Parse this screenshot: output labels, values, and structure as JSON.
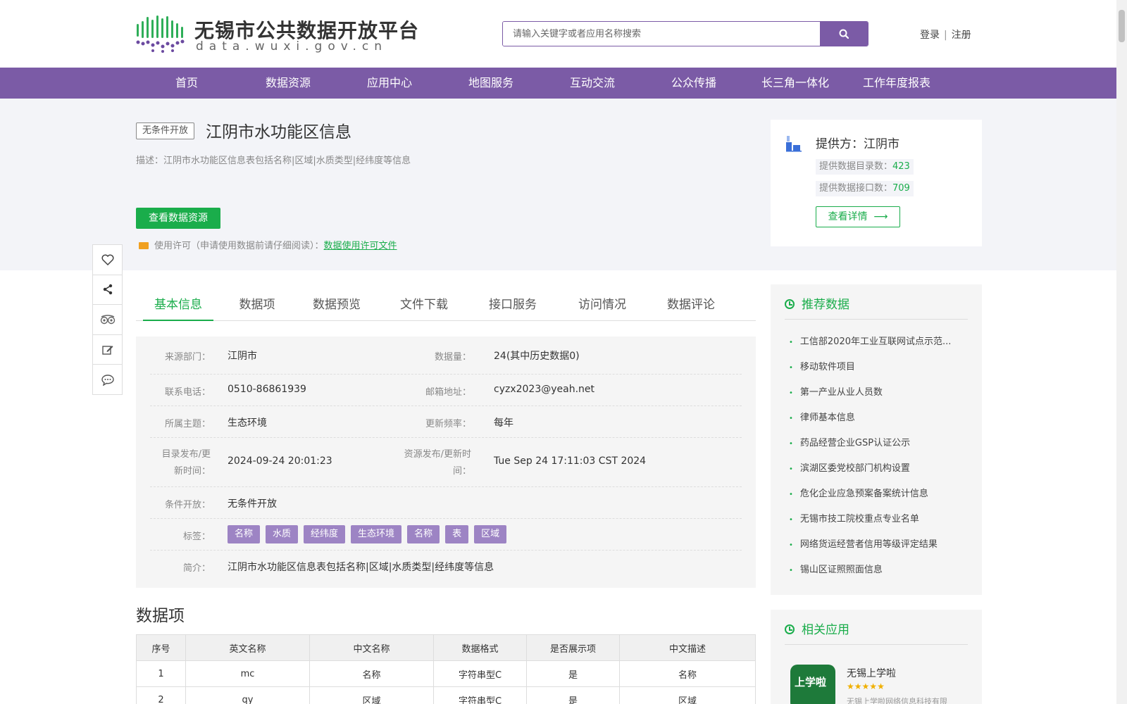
{
  "header": {
    "logo_title": "无锡市公共数据开放平台",
    "logo_sub": "data.wuxi.gov.cn",
    "search_placeholder": "请输入关键字或者应用名称搜索",
    "login": "登录",
    "sep": "|",
    "register": "注册"
  },
  "nav": [
    "首页",
    "数据资源",
    "应用中心",
    "地图服务",
    "互动交流",
    "公众传播",
    "长三角一体化",
    "工作年度报表"
  ],
  "dataset": {
    "badge": "无条件开放",
    "title": "江阴市水功能区信息",
    "desc": "描述：江阴市水功能区信息表包括名称|区域|水质类型|经纬度等信息",
    "view_button": "查看数据资源",
    "license_label": "使用许可（申请使用数据前请仔细阅读）：",
    "license_link": "数据使用许可文件"
  },
  "provider": {
    "name": "提供方：江阴市",
    "catalog_label": "提供数据目录数：",
    "catalog_count": "423",
    "api_label": "提供数据接口数：",
    "api_count": "709",
    "detail_button": "查看详情"
  },
  "tabs": [
    "基本信息",
    "数据项",
    "数据预览",
    "文件下载",
    "接口服务",
    "访问情况",
    "数据评论"
  ],
  "info": {
    "source_label": "来源部门：",
    "source": "江阴市",
    "volume_label": "数据量：",
    "volume": "24(其中历史数据0)",
    "phone_label": "联系电话：",
    "phone": "0510-86861939",
    "email_label": "邮箱地址：",
    "email": "cyzx2023@yeah.net",
    "theme_label": "所属主题：",
    "theme": "生态环境",
    "freq_label": "更新频率：",
    "freq": "每年",
    "catalog_time_label_1": "目录发布/更",
    "catalog_time_label_2": "新时间：",
    "catalog_time": "2024-09-24 20:01:23",
    "res_time_label_1": "资源发布/更新时",
    "res_time_label_2": "间：",
    "res_time": "Tue Sep 24 17:11:03 CST 2024",
    "open_label": "条件开放：",
    "open": "无条件开放",
    "tags_label": "标签：",
    "tags": [
      "名称",
      "水质",
      "经纬度",
      "生态环境",
      "名称",
      "表",
      "区域"
    ],
    "intro_label": "简介：",
    "intro": "江阴市水功能区信息表包括名称|区域|水质类型|经纬度等信息"
  },
  "data_items": {
    "heading": "数据项",
    "columns": [
      "序号",
      "英文名称",
      "中文名称",
      "数据格式",
      "是否展示项",
      "中文描述"
    ],
    "rows": [
      [
        "1",
        "mc",
        "名称",
        "字符串型C",
        "是",
        "名称"
      ],
      [
        "2",
        "qy",
        "区域",
        "字符串型C",
        "是",
        "区域"
      ]
    ]
  },
  "recommend": {
    "heading": "推荐数据",
    "items": [
      "工信部2020年工业互联网试点示范...",
      "移动软件项目",
      "第一产业从业人员数",
      "律师基本信息",
      "药品经营企业GSP认证公示",
      "滨湖区委党校部门机构设置",
      "危化企业应急预案备案统计信息",
      "无锡市技工院校重点专业名单",
      "网络货运经营者信用等级评定结果",
      "锡山区证照照面信息"
    ]
  },
  "related_apps": {
    "heading": "相关应用",
    "app_name": "无锡上学啦",
    "app_rating": 5,
    "app_desc": "无锡上学啦网络信息科技有限",
    "app_icon_text": "上学啦"
  },
  "colors": {
    "brand_purple": "#7b5ba6",
    "accent_green": "#1aad4b",
    "tag_purple": "#9d84c4"
  }
}
